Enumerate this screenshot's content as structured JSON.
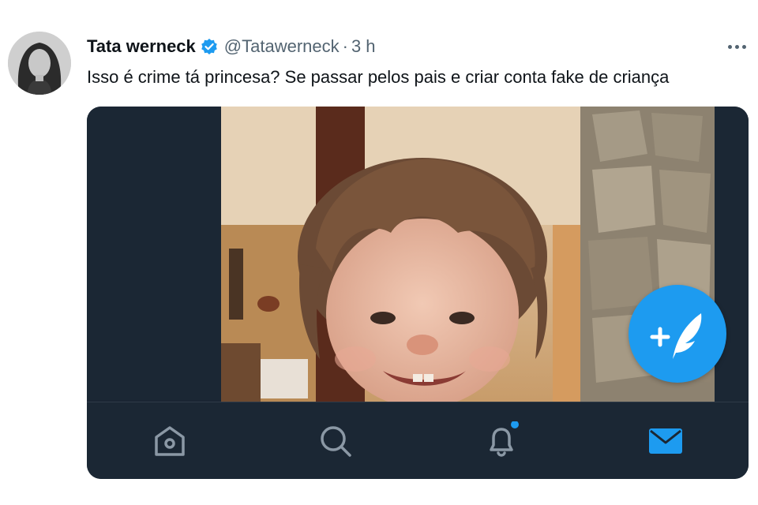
{
  "tweet": {
    "display_name": "Tata werneck",
    "handle": "@Tatawerneck",
    "separator": "·",
    "timestamp": "3 h",
    "text": "Isso é crime tá princesa? Se passar pelos pais e criar conta fake de criança"
  },
  "icons": {
    "verified": "verified-badge-icon",
    "more": "more-options-icon",
    "home": "home-icon",
    "search": "search-icon",
    "notifications": "bell-icon",
    "messages": "mail-icon",
    "compose": "compose-tweet-icon"
  },
  "colors": {
    "accent": "#1d9bf0",
    "app_dark": "#1b2734",
    "icon_muted": "#8b98a5",
    "text_primary": "#0f1419",
    "text_secondary": "#536471"
  },
  "nav": {
    "notifications_has_dot": true,
    "active_tab": "messages"
  }
}
